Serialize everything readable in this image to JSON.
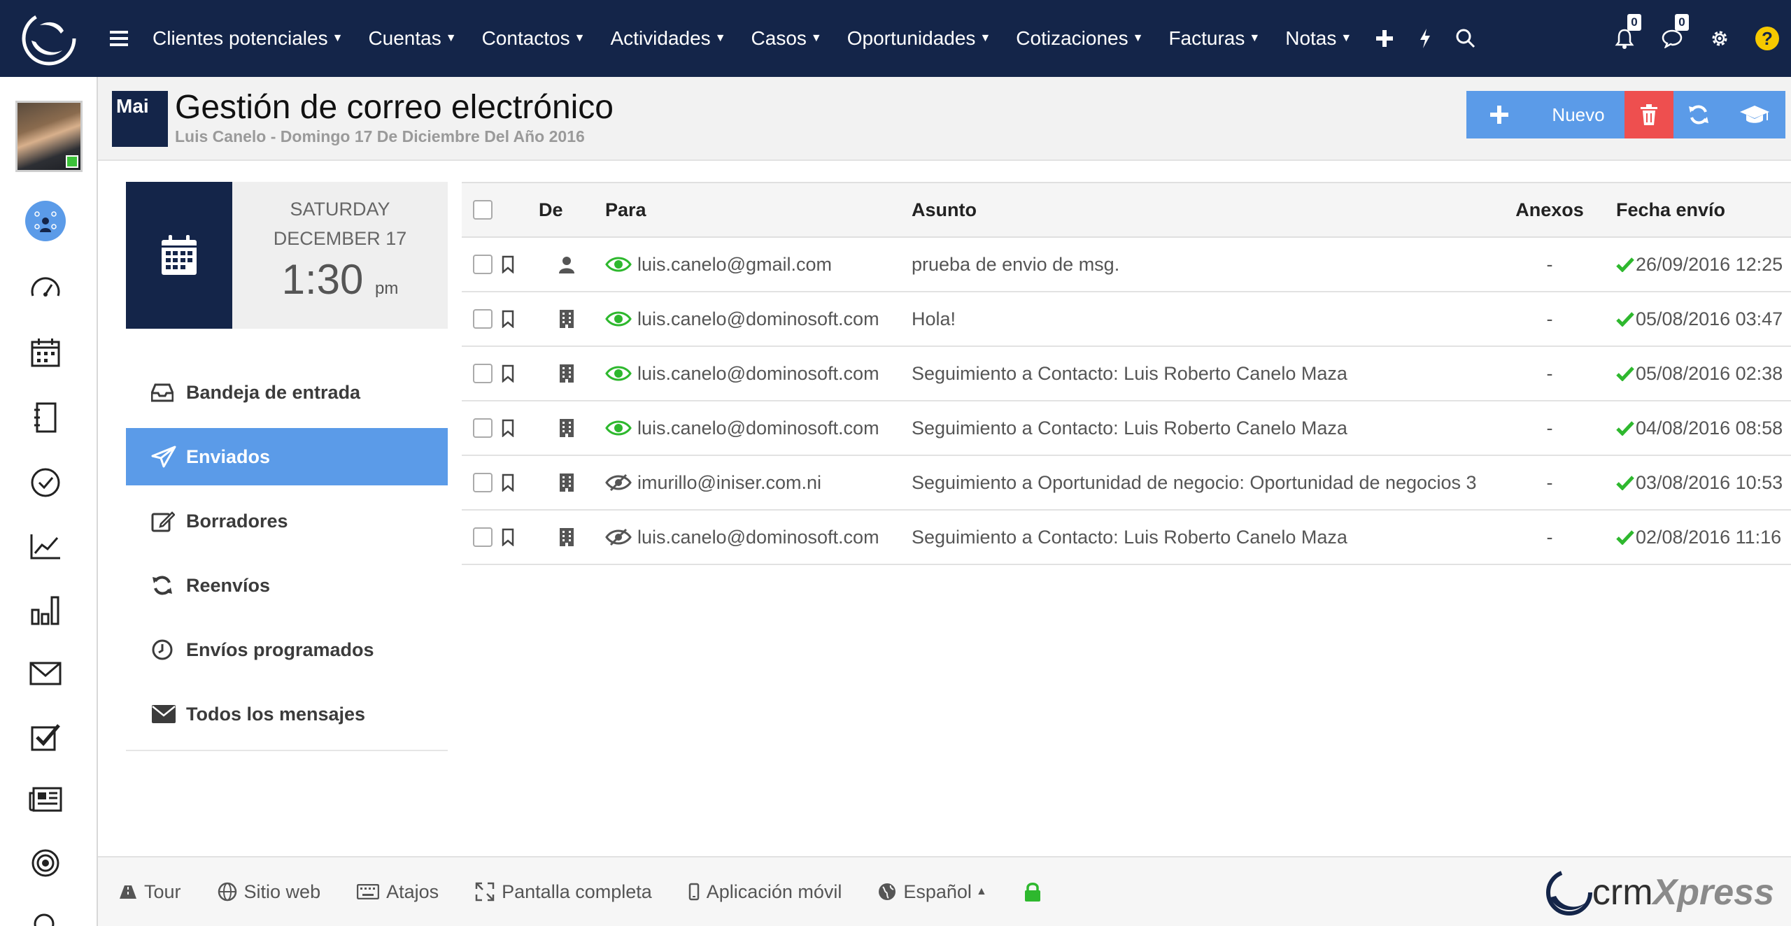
{
  "nav": {
    "items": [
      "Clientes potenciales",
      "Cuentas",
      "Contactos",
      "Actividades",
      "Casos",
      "Oportunidades",
      "Cotizaciones",
      "Facturas",
      "Notas"
    ],
    "notifications_count": "0",
    "messages_count": "0",
    "help_label": "?"
  },
  "header": {
    "module_badge": "Mai",
    "title": "Gestión de correo electrónico",
    "subtitle": "Luis Canelo - Domingo 17 De Diciembre Del Año 2016",
    "new_label": "Nuevo"
  },
  "datecard": {
    "weekday": "SATURDAY",
    "date": "DECEMBER 17",
    "time": "1:30",
    "ampm": "pm"
  },
  "folders": [
    {
      "label": "Bandeja de entrada",
      "icon": "inbox-icon",
      "active": false
    },
    {
      "label": "Enviados",
      "icon": "paper-plane-icon",
      "active": true
    },
    {
      "label": "Borradores",
      "icon": "edit-icon",
      "active": false
    },
    {
      "label": "Reenvíos",
      "icon": "refresh-icon",
      "active": false
    },
    {
      "label": "Envíos programados",
      "icon": "clock-icon",
      "active": false
    },
    {
      "label": "Todos los mensajes",
      "icon": "envelope-icon",
      "active": false
    }
  ],
  "table": {
    "headers": {
      "de": "De",
      "para": "Para",
      "asunto": "Asunto",
      "anexos": "Anexos",
      "fecha": "Fecha envío"
    },
    "rows": [
      {
        "de_icon": "user-icon",
        "read": true,
        "para": "luis.canelo@gmail.com",
        "asunto": "prueba de envio de msg.",
        "anexos": "-",
        "fecha": "26/09/2016 12:25"
      },
      {
        "de_icon": "building-icon",
        "read": true,
        "para": "luis.canelo@dominosoft.com",
        "asunto": "Hola!",
        "anexos": "-",
        "fecha": "05/08/2016 03:47"
      },
      {
        "de_icon": "building-icon",
        "read": true,
        "para": "luis.canelo@dominosoft.com",
        "asunto": "Seguimiento a Contacto: Luis Roberto Canelo Maza",
        "anexos": "-",
        "fecha": "05/08/2016 02:38"
      },
      {
        "de_icon": "building-icon",
        "read": true,
        "para": "luis.canelo@dominosoft.com",
        "asunto": "Seguimiento a Contacto: Luis Roberto Canelo Maza",
        "anexos": "-",
        "fecha": "04/08/2016 08:58"
      },
      {
        "de_icon": "building-icon",
        "read": false,
        "para": "imurillo@iniser.com.ni",
        "asunto": "Seguimiento a Oportunidad de negocio: Oportunidad de negocios 3",
        "anexos": "-",
        "fecha": "03/08/2016 10:53"
      },
      {
        "de_icon": "building-icon",
        "read": false,
        "para": "luis.canelo@dominosoft.com",
        "asunto": "Seguimiento a Contacto: Luis Roberto Canelo Maza",
        "anexos": "-",
        "fecha": "02/08/2016 11:16"
      }
    ]
  },
  "footer": {
    "tour": "Tour",
    "website": "Sitio web",
    "shortcuts": "Atajos",
    "fullscreen": "Pantalla completa",
    "mobile": "Aplicación móvil",
    "language": "Español",
    "brand_a": "crm",
    "brand_b": "Xpress"
  },
  "colors": {
    "nav_bg": "#142549",
    "accent": "#5b9be8",
    "danger": "#ee4f4f",
    "success": "#2eb82e"
  }
}
